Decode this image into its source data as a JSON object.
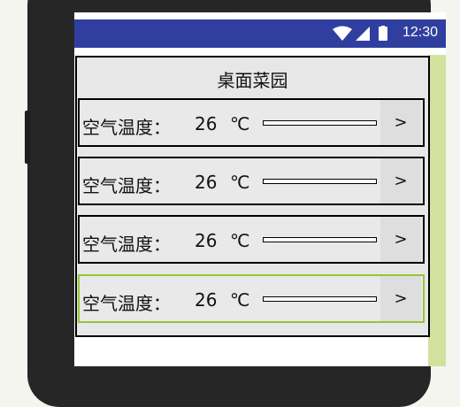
{
  "status": {
    "time": "12:30"
  },
  "app": {
    "title": "桌面菜园",
    "rows": [
      {
        "label": "空气温度：",
        "value": "26",
        "unit": "℃",
        "button": ">"
      },
      {
        "label": "空气温度：",
        "value": "26",
        "unit": "℃",
        "button": ">"
      },
      {
        "label": "空气温度：",
        "value": "26",
        "unit": "℃",
        "button": ">"
      },
      {
        "label": "空气温度：",
        "value": "26",
        "unit": "℃",
        "button": ">"
      }
    ]
  },
  "colors": {
    "status_bar": "#303f9f",
    "panel_bg": "#e7e7e7",
    "focus_border": "#9bc43a",
    "side_strip": "#d2e19d"
  }
}
